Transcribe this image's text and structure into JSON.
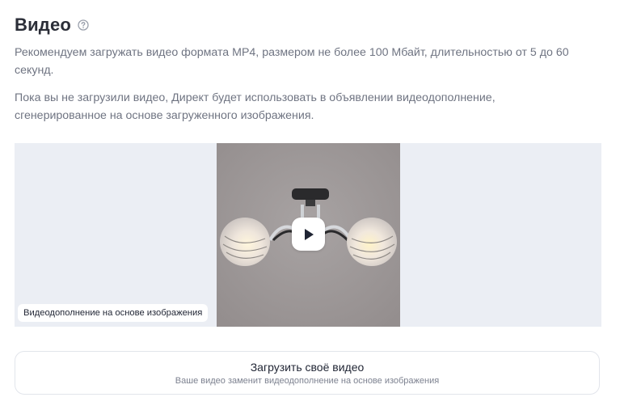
{
  "section": {
    "title": "Видео",
    "help_icon": "question-circle-icon",
    "recommendation": "Рекомендуем загружать видео формата MP4, размером не более 100 Мбайт, длительностью от 5 до 60 секунд.",
    "note": "Пока вы не загрузили видео, Директ будет использовать в объявлении видеодополнение, сгенерированное на основе загруженного изображения."
  },
  "preview": {
    "badge": "Видеодополнение на основе изображения",
    "play_icon": "play-icon",
    "image": "ceiling-lamp-with-two-glass-shades"
  },
  "upload": {
    "label": "Загрузить своё видео",
    "hint": "Ваше видео заменит видеодополнение на основе изображения"
  },
  "colors": {
    "preview_bg": "#ebeef4",
    "thumb_bg": "#a09a9a",
    "muted_text": "#6f7482"
  }
}
